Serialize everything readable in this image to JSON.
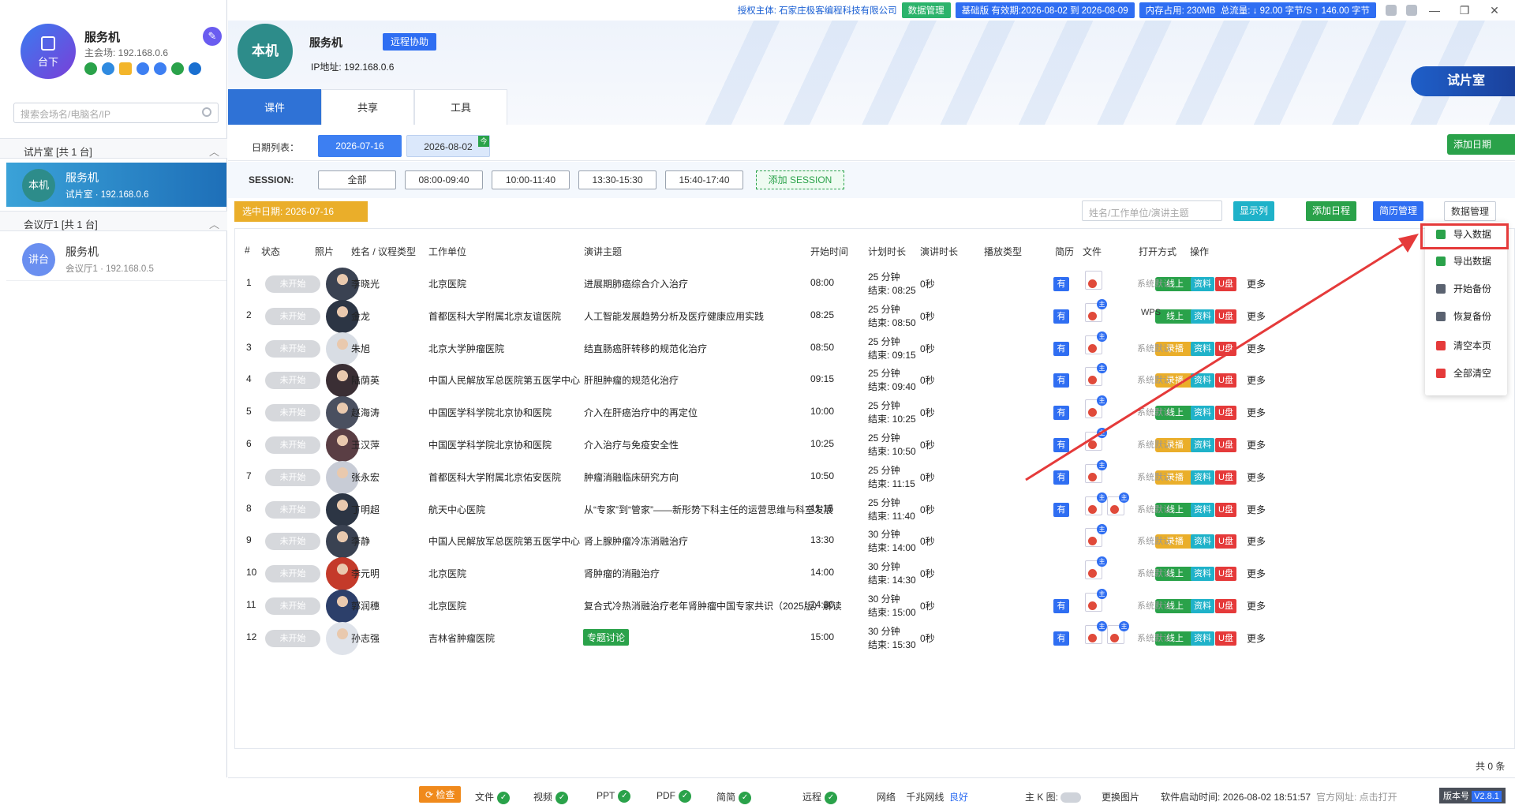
{
  "topbar": {
    "license": "授权主体: 石家庄极客编程科技有限公司",
    "data_mgmt": "数据管理",
    "validity": "基础版 有效期:2026-08-02 到 2026-08-09",
    "memory": "内存占用: 230MB",
    "traffic": "总流量: ↓ 92.00 字节/S ↑ 146.00 字节",
    "win_min": "—",
    "win_max": "❐",
    "win_close": "✕"
  },
  "left": {
    "avatar_label": "台下",
    "name": "服务机",
    "ip": "主会场: 192.168.0.6",
    "search_placeholder": "搜索会场名/电脑名/IP",
    "groups": [
      {
        "title": "试片室   [共 1 台]"
      },
      {
        "title": "会议厅1   [共 1 台]"
      }
    ],
    "devices": [
      {
        "av": "本机",
        "name": "服务机",
        "sub": "试片室 · 192.168.0.6"
      },
      {
        "av": "讲台",
        "name": "服务机",
        "sub": "会议厅1 · 192.168.0.5"
      }
    ]
  },
  "header": {
    "avatar": "本机",
    "name": "服务机",
    "remote": "远程协助",
    "ip": "IP地址: 192.168.0.6",
    "room": "试片室",
    "tabs": [
      "课件",
      "共享",
      "工具"
    ]
  },
  "dates": {
    "label": "日期列表：",
    "d1": "2026-07-16",
    "d2": "2026-08-02",
    "today": "今",
    "add": "添加日期"
  },
  "session": {
    "label": "SESSION:",
    "items": [
      "全部",
      "08:00-09:40",
      "10:00-11:40",
      "13:30-15:30",
      "15:40-17:40"
    ],
    "add": "添加 SESSION"
  },
  "toolbar": {
    "selected": "选中日期:  2026-07-16",
    "search_placeholder": "姓名/工作单位/演讲主题",
    "show_cols": "显示列",
    "add_schedule": "添加日程",
    "bio_mgmt": "简历管理",
    "data_mgmt": "数据管理"
  },
  "columns": [
    "#",
    "状态",
    "照片",
    "姓名 / 议程类型",
    "工作单位",
    "演讲主题",
    "开始时间",
    "计划时长",
    "演讲时长",
    "播放类型",
    "简历",
    "文件",
    "打开方式",
    "操作"
  ],
  "status_label": "未开始",
  "bio_label": "有",
  "open_default": "系统默认",
  "btn_zl": "资料",
  "btn_u": "U盘",
  "btn_more": "更多",
  "speech_dur": "0秒",
  "rows": [
    {
      "n": "1",
      "name": "李晓光",
      "org": "北京医院",
      "topic": "进展期肺癌综合介入治疗",
      "start": "08:00",
      "plan": "25 分钟",
      "end": "结束: 08:25",
      "play": "线上"
    },
    {
      "n": "2",
      "name": "金龙",
      "org": "首都医科大学附属北京友谊医院",
      "topic": "人工智能发展趋势分析及医疗健康应用实践",
      "start": "08:25",
      "plan": "25 分钟",
      "end": "结束: 08:50",
      "play": "线上",
      "open": "WPS"
    },
    {
      "n": "3",
      "name": "朱旭",
      "org": "北京大学肿瘤医院",
      "topic": "结直肠癌肝转移的规范化治疗",
      "start": "08:50",
      "plan": "25 分钟",
      "end": "结束: 09:15",
      "play": "录播"
    },
    {
      "n": "4",
      "name": "陆荫英",
      "org": "中国人民解放军总医院第五医学中心",
      "topic": "肝胆肿瘤的规范化治疗",
      "start": "09:15",
      "plan": "25 分钟",
      "end": "结束: 09:40",
      "play": "录播"
    },
    {
      "n": "5",
      "name": "赵海涛",
      "org": "中国医学科学院北京协和医院",
      "topic": "介入在肝癌治疗中的再定位",
      "start": "10:00",
      "plan": "25 分钟",
      "end": "结束: 10:25",
      "play": "线上"
    },
    {
      "n": "6",
      "name": "王汉萍",
      "org": "中国医学科学院北京协和医院",
      "topic": "介入治疗与免疫安全性",
      "start": "10:25",
      "plan": "25 分钟",
      "end": "结束: 10:50",
      "play": "录播"
    },
    {
      "n": "7",
      "name": "张永宏",
      "org": "首都医科大学附属北京佑安医院",
      "topic": "肿瘤消融临床研究方向",
      "start": "10:50",
      "plan": "25 分钟",
      "end": "结束: 11:15",
      "play": "录播"
    },
    {
      "n": "8",
      "name": "丁明超",
      "org": "航天中心医院",
      "topic": "从“专家”到“管家”——新形势下科主任的运营思维与科室发展",
      "start": "11:15",
      "plan": "25 分钟",
      "end": "结束: 11:40",
      "play": "线上"
    },
    {
      "n": "9",
      "name": "李静",
      "org": "中国人民解放军总医院第五医学中心",
      "topic": "肾上腺肿瘤冷冻消融治疗",
      "start": "13:30",
      "plan": "30 分钟",
      "end": "结束: 14:00",
      "play": "录播"
    },
    {
      "n": "10",
      "name": "李元明",
      "org": "北京医院",
      "topic": "肾肿瘤的消融治疗",
      "start": "14:00",
      "plan": "30 分钟",
      "end": "结束: 14:30",
      "play": "线上"
    },
    {
      "n": "11",
      "name": "郭润穗",
      "org": "北京医院",
      "topic": "复合式冷热消融治疗老年肾肿瘤中国专家共识（2025版）解读",
      "start": "14:30",
      "plan": "30 分钟",
      "end": "结束: 15:00",
      "play": "线上"
    },
    {
      "n": "12",
      "name": "孙志强",
      "org": "吉林省肿瘤医院",
      "topic": "专题讨论",
      "start": "15:00",
      "plan": "30 分钟",
      "end": "结束: 15:30",
      "play": "线上"
    }
  ],
  "dropdown": [
    "导入数据",
    "导出数据",
    "开始备份",
    "恢复备份",
    "清空本页",
    "全部清空"
  ],
  "total": "共 0 条",
  "statusbar": {
    "check": "检查",
    "file": "文件",
    "video": "视频",
    "ppt": "PPT",
    "pdf": "PDF",
    "bio": "简简",
    "remote": "远程",
    "net": "网络",
    "gbnet": "千兆网线",
    "good": "良好",
    "kmain": "主 K 图:",
    "change_img": "更换图片",
    "start_time": "软件启动时间:  2026-08-02 18:51:57",
    "site": "官方网址:  点击打开",
    "ver_label": "版本号",
    "version": "V2.8.1"
  }
}
